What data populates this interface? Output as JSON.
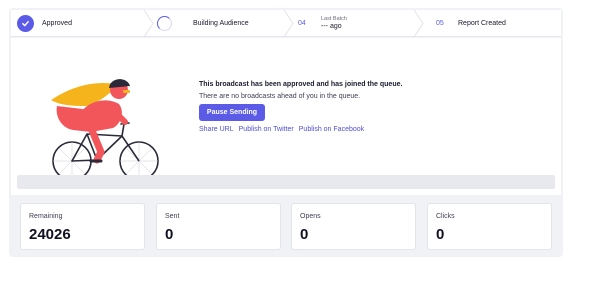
{
  "steps": [
    {
      "label": "Approved",
      "state": "complete"
    },
    {
      "label": "Building Audience",
      "state": "in-progress"
    },
    {
      "number": "04",
      "label": "Last Batch",
      "value": "--- ago"
    },
    {
      "number": "05",
      "label": "Report Created"
    }
  ],
  "message": {
    "title": "This broadcast has been approved and has joined the queue.",
    "subtitle": "There are no broadcasts ahead of you in the queue."
  },
  "actions": {
    "pause_label": "Pause Sending",
    "share_url": "Share URL",
    "publish_twitter": "Publish on Twitter",
    "publish_facebook": "Publish on Facebook"
  },
  "progress": {
    "fraction": 0
  },
  "stats": [
    {
      "label": "Remaining",
      "value": "24026"
    },
    {
      "label": "Sent",
      "value": "0"
    },
    {
      "label": "Opens",
      "value": "0"
    },
    {
      "label": "Clicks",
      "value": "0"
    }
  ],
  "colors": {
    "accent": "#5b5be8",
    "link": "#4f4fd6",
    "rider": "#f2555a",
    "cape": "#f5b41c"
  },
  "icons": [
    "check-icon",
    "spinner-icon",
    "cyclist-illustration"
  ]
}
